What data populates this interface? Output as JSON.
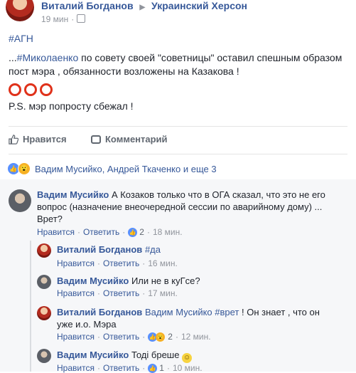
{
  "post": {
    "author": "Виталий Богданов",
    "group": "Украинский Херсон",
    "time": "19 мин",
    "hashtag": "#АГН",
    "line1_prefix": "...",
    "line1_tag": "#Миколаенко",
    "line1_rest": " по совету своей \"советницы\" оставил спешным образом",
    "line2": "пост мэра , обязанности возложены на Казакова !",
    "ps": "P.S. мэр попросту сбежал !",
    "like_label": "Нравится",
    "comment_label": "Комментарий",
    "reactions_text": "Вадим Мусийко, Андрей Ткаченко и еще 3"
  },
  "comments": [
    {
      "author": "Вадим Мусийко",
      "text": " А Козаков только что в ОГА сказал, что это не его",
      "text2": "вопрос (назначение внеочередной сессии по аварийному дому) ...",
      "text3": "Врет?",
      "like": "Нравится",
      "reply": "Ответить",
      "reactions": "2",
      "time": "18 мин."
    }
  ],
  "replies": [
    {
      "author": "Виталий Богданов",
      "tag": "#да",
      "like": "Нравится",
      "reply": "Ответить",
      "time": "16 мин."
    },
    {
      "author": "Вадим Мусийко",
      "text": " Или не в куГсе?",
      "like": "Нравится",
      "reply": "Ответить",
      "time": "17 мин."
    },
    {
      "author": "Виталий Богданов",
      "mention": "Вадим Мусийко",
      "tag": "#врет",
      "text": " ! Он знает , что он",
      "text2": "уже и.о. Мэра",
      "like": "Нравится",
      "reply": "Ответить",
      "reactions": "2",
      "time": "12 мин."
    },
    {
      "author": "Вадим Мусийко",
      "text": " Тоді бреше",
      "like": "Нравится",
      "reply": "Ответить",
      "reactions": "1",
      "time": "10 мин."
    }
  ]
}
